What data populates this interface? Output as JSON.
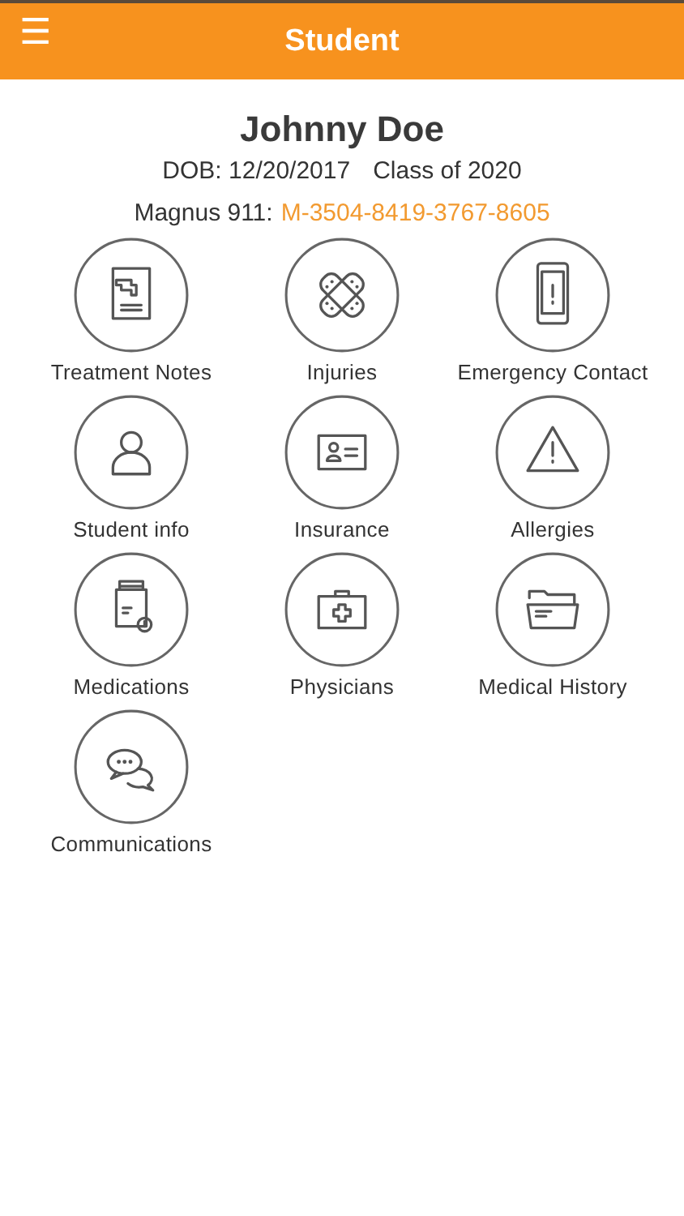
{
  "header": {
    "menu_icon": "☰",
    "title": "Student"
  },
  "student": {
    "name": "Johnny Doe",
    "dob": "DOB: 12/20/2017",
    "class": "Class of 2020",
    "magnus_label": "Magnus 911:",
    "magnus_id": "M-3504-8419-3767-8605"
  },
  "tiles": [
    {
      "label": "Treatment Notes",
      "kind": "document"
    },
    {
      "label": "Injuries",
      "kind": "bandage"
    },
    {
      "label": "Emergency Contact",
      "kind": "phone"
    },
    {
      "label": "Student info",
      "kind": "person"
    },
    {
      "label": "Insurance",
      "kind": "card"
    },
    {
      "label": "Allergies",
      "kind": "warning"
    },
    {
      "label": "Medications",
      "kind": "bottle"
    },
    {
      "label": "Physicians",
      "kind": "bag"
    },
    {
      "label": "Medical History",
      "kind": "folder"
    },
    {
      "label": "Communications",
      "kind": "chat"
    }
  ]
}
